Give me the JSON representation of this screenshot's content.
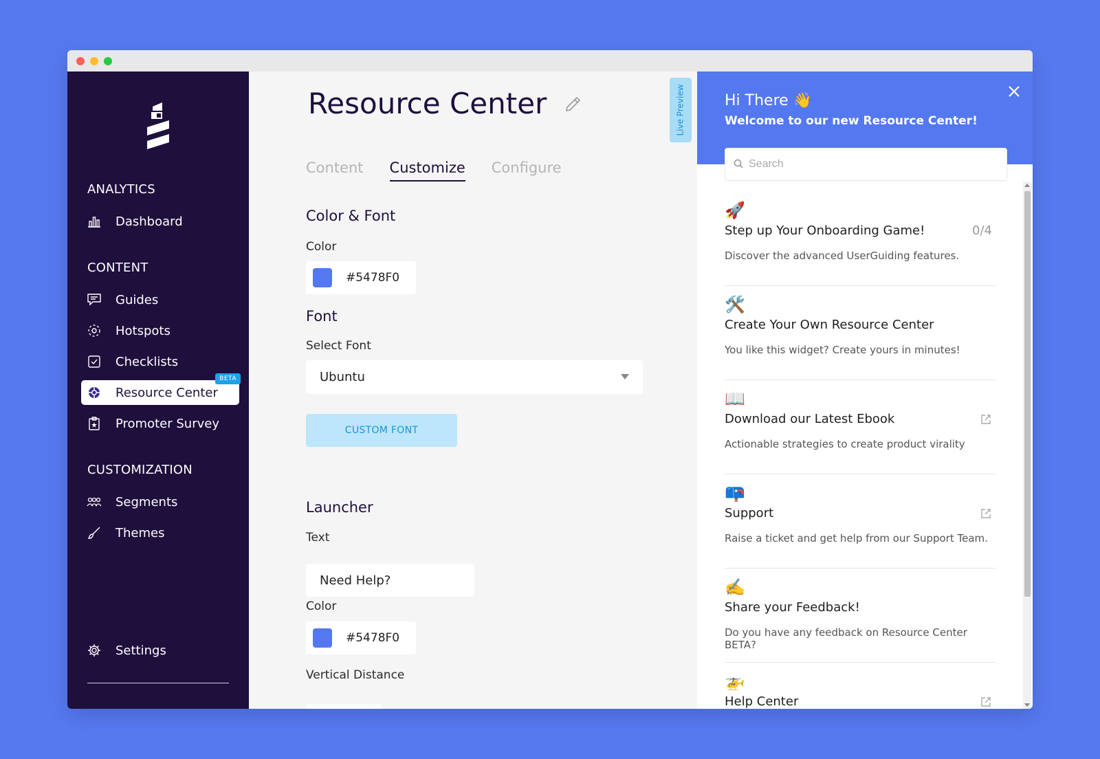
{
  "sidebar": {
    "sections": {
      "analytics": "ANALYTICS",
      "content": "CONTENT",
      "customization": "CUSTOMIZATION"
    },
    "items": {
      "dashboard": "Dashboard",
      "guides": "Guides",
      "hotspots": "Hotspots",
      "checklists": "Checklists",
      "resource_center": "Resource Center",
      "promoter_survey": "Promoter Survey",
      "segments": "Segments",
      "themes": "Themes",
      "settings": "Settings"
    },
    "beta_badge": "BETA"
  },
  "main": {
    "title": "Resource Center",
    "tabs": [
      "Content",
      "Customize",
      "Configure"
    ],
    "active_tab": "Customize",
    "color_font_heading": "Color & Font",
    "color_label": "Color",
    "color_value": "#5478F0",
    "font_heading": "Font",
    "select_font_label": "Select Font",
    "select_font_value": "Ubuntu",
    "custom_font_button": "CUSTOM FONT",
    "launcher_heading": "Launcher",
    "text_label": "Text",
    "text_value": "Need Help?",
    "launcher_color_label": "Color",
    "launcher_color_value": "#5478F0",
    "vertical_distance_label": "Vertical Distance"
  },
  "live_preview": "Live Preview",
  "preview": {
    "greeting": "Hi There 👋",
    "welcome": "Welcome to our new Resource Center!",
    "search_placeholder": "Search",
    "items": [
      {
        "emoji": "🚀",
        "title": "Step up Your Onboarding Game!",
        "desc": "Discover the advanced UserGuiding features.",
        "count": "0/4"
      },
      {
        "emoji": "🛠️",
        "title": "Create Your Own Resource Center",
        "desc": "You like this widget? Create yours in minutes!"
      },
      {
        "emoji": "📖",
        "title": "Download our Latest Ebook",
        "desc": "Actionable strategies to create product virality"
      },
      {
        "emoji": "📪",
        "title": "Support",
        "desc": "Raise a ticket and get help from our Support Team."
      },
      {
        "emoji": "✍️",
        "title": "Share your Feedback!",
        "desc": "Do you have any feedback on Resource Center BETA?"
      },
      {
        "emoji": "🚁",
        "title": "Help Center",
        "desc": ""
      }
    ]
  },
  "colors": {
    "brand": "#5478F0",
    "sidebar": "#1e0f3d",
    "accent_light": "#bde6fb"
  }
}
